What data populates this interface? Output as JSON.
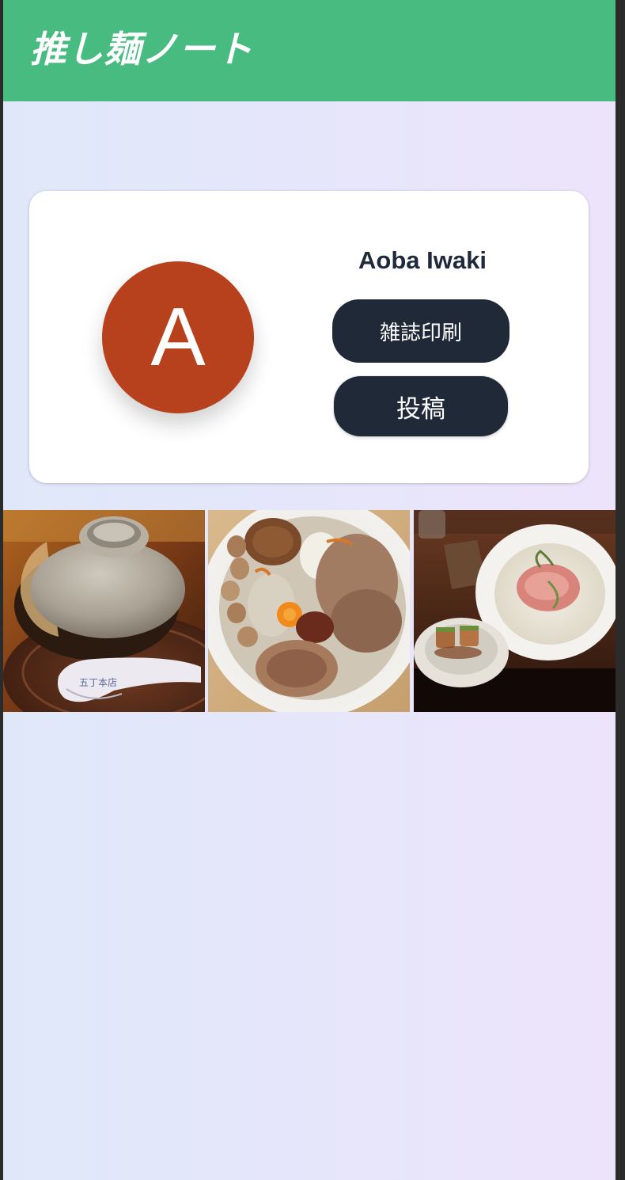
{
  "app": {
    "title": "推し麺ノート",
    "header_color": "#48bb80"
  },
  "profile": {
    "avatar_letter": "A",
    "avatar_color": "#b7411d",
    "name": "Aoba Iwaki",
    "print_button_label": "雑誌印刷",
    "post_button_label": "投稿"
  },
  "photos": [
    {
      "subject": "clay pot dish with lid and spoon",
      "spoon_text": "五丁本店"
    },
    {
      "subject": "mazesoba bowl with eggs, chashu and toppings"
    },
    {
      "subject": "creamy ramen with rare pork and side dish"
    }
  ]
}
